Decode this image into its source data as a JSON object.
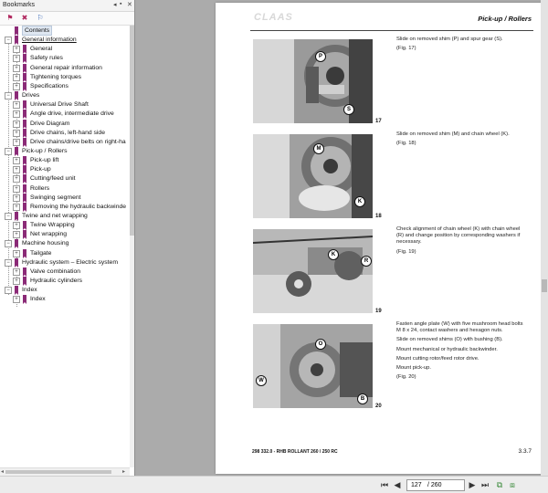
{
  "bookmarks": {
    "header_title": "Bookmarks",
    "tree": [
      {
        "label": "Contents",
        "level": 0,
        "toggle": "",
        "selected": true
      },
      {
        "label": "General information",
        "level": 0,
        "toggle": "-",
        "chapter": true
      },
      {
        "label": "General",
        "level": 1,
        "toggle": "+"
      },
      {
        "label": "Safety rules",
        "level": 1,
        "toggle": "+"
      },
      {
        "label": "General repair information",
        "level": 1,
        "toggle": "+"
      },
      {
        "label": "Tightening torques",
        "level": 1,
        "toggle": "+"
      },
      {
        "label": "Specifications",
        "level": 1,
        "toggle": "+"
      },
      {
        "label": "Drives",
        "level": 0,
        "toggle": "-"
      },
      {
        "label": "Universal Drive Shaft",
        "level": 1,
        "toggle": "+"
      },
      {
        "label": "Angle drive, intermediate drive",
        "level": 1,
        "toggle": "+"
      },
      {
        "label": "Drive Diagram",
        "level": 1,
        "toggle": "+"
      },
      {
        "label": "Drive chains, left-hand side",
        "level": 1,
        "toggle": "+"
      },
      {
        "label": "Drive chains/drive belts on right-ha",
        "level": 1,
        "toggle": "+"
      },
      {
        "label": "Pick-up / Rollers",
        "level": 0,
        "toggle": "-"
      },
      {
        "label": "Pick-up lift",
        "level": 1,
        "toggle": "+"
      },
      {
        "label": "Pick-up",
        "level": 1,
        "toggle": "+"
      },
      {
        "label": "Cutting/feed unit",
        "level": 1,
        "toggle": "+"
      },
      {
        "label": "Rollers",
        "level": 1,
        "toggle": "+"
      },
      {
        "label": "Swinging segment",
        "level": 1,
        "toggle": "+"
      },
      {
        "label": "Removing the hydraulic backwinde",
        "level": 1,
        "toggle": "+"
      },
      {
        "label": "Twine and net wrapping",
        "level": 0,
        "toggle": "-"
      },
      {
        "label": "Twine Wrapping",
        "level": 1,
        "toggle": "+"
      },
      {
        "label": "Net wrapping",
        "level": 1,
        "toggle": "+"
      },
      {
        "label": "Machine housing",
        "level": 0,
        "toggle": "-"
      },
      {
        "label": "Tailgate",
        "level": 1,
        "toggle": "+"
      },
      {
        "label": "Hydraulic system – Electric system",
        "level": 0,
        "toggle": "-"
      },
      {
        "label": "Valve combination",
        "level": 1,
        "toggle": "+"
      },
      {
        "label": "Hydraulic cylinders",
        "level": 1,
        "toggle": "+"
      },
      {
        "label": "Index",
        "level": 0,
        "toggle": "-"
      },
      {
        "label": "Index",
        "level": 1,
        "toggle": "+"
      }
    ]
  },
  "page": {
    "logo_text": "CLAAS",
    "section_title": "Pick-up / Rollers",
    "figures": [
      {
        "number": "17",
        "callouts": [
          "P",
          "S"
        ],
        "caption": [
          "Slide on removed shim (P) and spur gear (S).",
          "(Fig. 17)"
        ]
      },
      {
        "number": "18",
        "callouts": [
          "M",
          "K"
        ],
        "caption": [
          "Slide on removed shim (M) and chain wheel (K).",
          "(Fig. 18)"
        ]
      },
      {
        "number": "19",
        "callouts": [
          "K",
          "R"
        ],
        "caption": [
          "Check alignment of chain wheel (K) with chain wheel (R) and change position by corresponding washers if necessary.",
          "(Fig. 19)"
        ]
      },
      {
        "number": "20",
        "callouts": [
          "O",
          "W",
          "B"
        ],
        "caption": [
          "Fasten angle plate (W) with five mushroom head bolts M 8 x 24, contact washers and hexagon nuts.",
          "Slide on removed shims (O) with bushing (B).",
          "Mount mechanical or hydraulic backwinder.",
          "Mount cutting rotor/feed rotor drive.",
          "Mount pick-up.",
          "(Fig. 20)"
        ]
      }
    ],
    "footer_text": "298 332.0 - RHB ROLLANT 260 / 250 RC",
    "page_label": "3.3.7"
  },
  "nav": {
    "current_page": "127",
    "total_pages": "/ 260"
  },
  "colors": {
    "bookmark_icon": "#8b2a77",
    "viewer_bg": "#ababab"
  }
}
